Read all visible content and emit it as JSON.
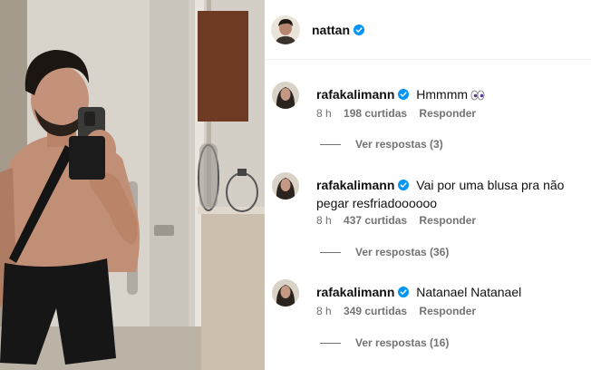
{
  "post": {
    "author": "nattan",
    "author_avatar_icon": "profile-avatar",
    "verified_icon": "verified-badge-icon",
    "verified_color": "#0095f6"
  },
  "comments": [
    {
      "username": "rafakalimann",
      "text": "Hmmmm",
      "emoji_icon": "eyes-emoji",
      "time": "8 h",
      "likes": "198 curtidas",
      "reply_label": "Responder",
      "view_replies": "Ver respostas (3)"
    },
    {
      "username": "rafakalimann",
      "text": "Vai por uma blusa pra não pegar resfriadoooooo",
      "time": "8 h",
      "likes": "437 curtidas",
      "reply_label": "Responder",
      "view_replies": "Ver respostas (36)"
    },
    {
      "username": "rafakalimann",
      "text": "Natanael Natanael",
      "time": "8 h",
      "likes": "349 curtidas",
      "reply_label": "Responder",
      "view_replies": "Ver respostas (16)"
    }
  ]
}
